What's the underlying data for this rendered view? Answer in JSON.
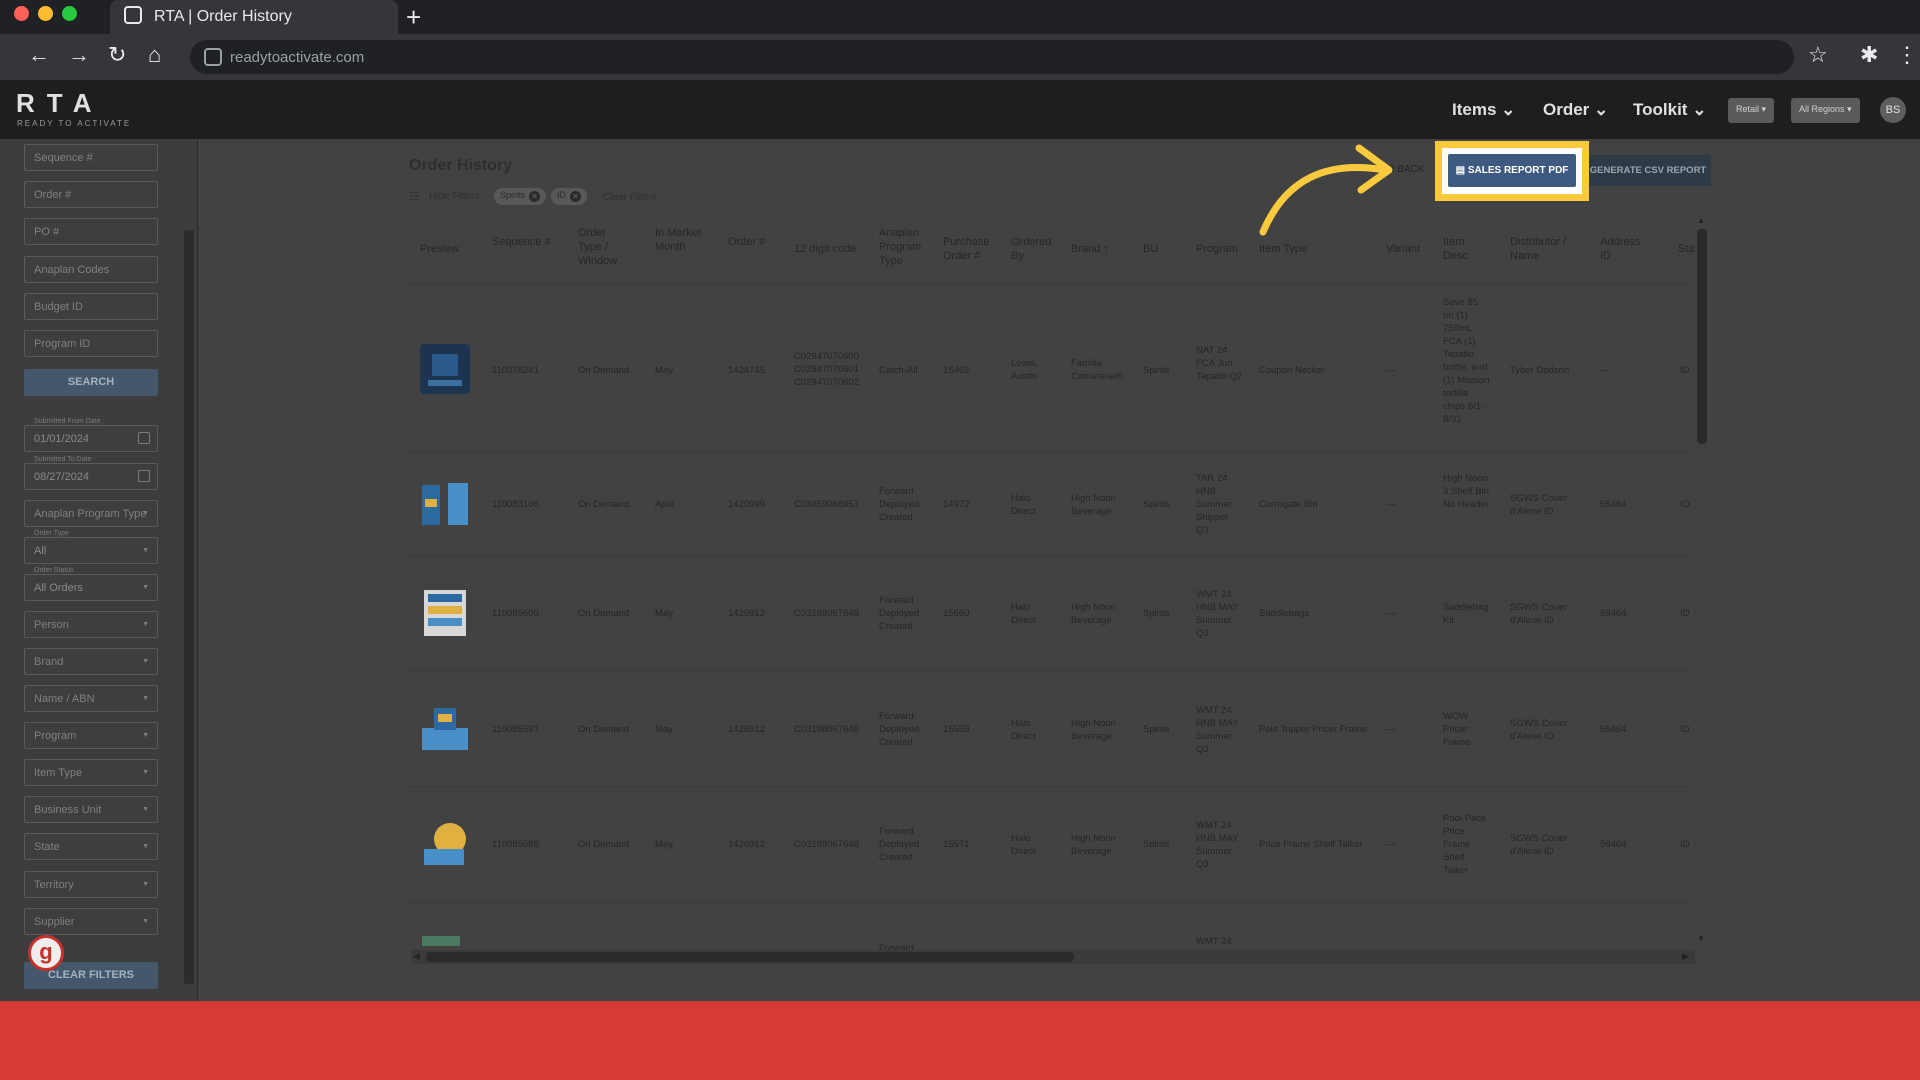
{
  "browser": {
    "tab_title": "RTA | Order History",
    "url": "readytoactivate.com",
    "new_tab_symbol": "+"
  },
  "app": {
    "logo": "RTA",
    "logo_sub": "READY TO ACTIVATE",
    "nav": [
      "Items",
      "Order",
      "Toolkit"
    ],
    "chips": [
      "Retail",
      "All Regions"
    ],
    "avatar": "BS"
  },
  "sidebar": {
    "fields": [
      {
        "placeholder": "Sequence #"
      },
      {
        "placeholder": "Order #"
      },
      {
        "placeholder": "PO #"
      },
      {
        "placeholder": "Anaplan Codes"
      },
      {
        "placeholder": "Budget ID"
      },
      {
        "placeholder": "Program ID"
      }
    ],
    "search_label": "SEARCH",
    "from_date_label": "Submitted From Date",
    "from_date": "01/01/2024",
    "to_date_label": "Submitted To Date",
    "to_date": "08/27/2024",
    "anaplan_program_type": "Anaplan Program Type",
    "order_type_label": "Order Type",
    "order_type": "All",
    "order_status_label": "Order Status",
    "order_status": "All Orders",
    "selects": [
      "Person",
      "Brand",
      "Name / ABN",
      "Program",
      "Item Type",
      "Business Unit",
      "State",
      "Territory",
      "Supplier"
    ],
    "clear_label": "CLEAR FILTERS",
    "badge": "g"
  },
  "main": {
    "title": "Order History",
    "hide_filters": "Hide Filters",
    "filter_chips": [
      "Spirits",
      "ID"
    ],
    "clear_filters": "Clear Filters",
    "back": "BACK",
    "sales_report_pdf": "SALES REPORT PDF",
    "generate_csv": "GENERATE CSV REPORT"
  },
  "table": {
    "headers": [
      "Preview",
      "Sequence #",
      "Order Type / Window",
      "In Market Month",
      "Order #",
      "12 digit code",
      "Anaplan Program Type",
      "Purchase Order #",
      "Ordered By",
      "Brand",
      "BU",
      "Program",
      "Item Type",
      "Variant",
      "Item Desc.",
      "Distributor / Name",
      "Address ID",
      "Sta"
    ],
    "rows": [
      {
        "seq": "110078241",
        "type": "On Demand",
        "month": "May",
        "order": "1424745",
        "code": "C02947070600 C02947070601 C02947070602",
        "anaplan": "Catch-All",
        "po": "15462",
        "by": "Lewis, Austin",
        "brand": "Familia Camarena®",
        "bu": "Spirits",
        "program": "NAT 24 FCA Jun Tapatio Q2",
        "item_type": "Coupon Necker",
        "variant": "—",
        "desc": "Save $5 on (1) 750mL FCA (1) Tapatio bottle, and (1) Mission tortilla chips 6/1 - 8/31",
        "dist": "Tyber Dodson",
        "addr": "—",
        "state": "ID"
      },
      {
        "seq": "110083106",
        "type": "On Demand",
        "month": "April",
        "order": "1420999",
        "code": "C03459068957",
        "anaplan": "Forward Deployed Created",
        "po": "14972",
        "by": "Halo Direct",
        "brand": "High Noon Beverage",
        "bu": "Spirits",
        "program": "TAR 24 HNB Summer Shipper Q3",
        "item_type": "Corrugate Bin",
        "variant": "—",
        "desc": "High Noon 3 Shelf Bin No Header",
        "dist": "SGWS Couer d'Alene ID",
        "addr": "56464",
        "state": "ID"
      },
      {
        "seq": "110085600",
        "type": "On Demand",
        "month": "May",
        "order": "1426912",
        "code": "C03188067648",
        "anaplan": "Forward Deployed Created",
        "po": "15560",
        "by": "Halo Direct",
        "brand": "High Noon Beverage",
        "bu": "Spirits",
        "program": "WMT 24 HNB MAY Summer Q3",
        "item_type": "Saddlebags",
        "variant": "—",
        "desc": "Saddlebag Kit",
        "dist": "SGWS Couer d'Alene ID",
        "addr": "56464",
        "state": "ID"
      },
      {
        "seq": "110085587",
        "type": "On Demand",
        "month": "May",
        "order": "1426912",
        "code": "C03188067648",
        "anaplan": "Forward Deployed Created",
        "po": "15559",
        "by": "Halo Direct",
        "brand": "High Noon Beverage",
        "bu": "Spirits",
        "program": "WMT 24 HNB MAY Summer Q3",
        "item_type": "Pole Topper Pricer Frame",
        "variant": "—",
        "desc": "WOW Pricer Frame",
        "dist": "SGWS Couer d'Alene ID",
        "addr": "56464",
        "state": "ID"
      },
      {
        "seq": "110085588",
        "type": "On Demand",
        "month": "May",
        "order": "1426912",
        "code": "C03188067648",
        "anaplan": "Forward Deployed Created",
        "po": "15571",
        "by": "Halo Direct",
        "brand": "High Noon Beverage",
        "bu": "Spirits",
        "program": "WMT 24 HNB MAY Summer Q3",
        "item_type": "Price Frame Shelf Talker",
        "variant": "—",
        "desc": "Pool Pack Price Frame Shelf Talker",
        "dist": "SGWS Couer d'Alene ID",
        "addr": "56464",
        "state": "ID"
      }
    ],
    "partial_row": {
      "anaplan": "Forward",
      "program": "WMT 24"
    }
  },
  "colors": {
    "highlight": "#f9c93e",
    "primary_button": "#3f5a80",
    "bottom_band": "#d63a35"
  }
}
